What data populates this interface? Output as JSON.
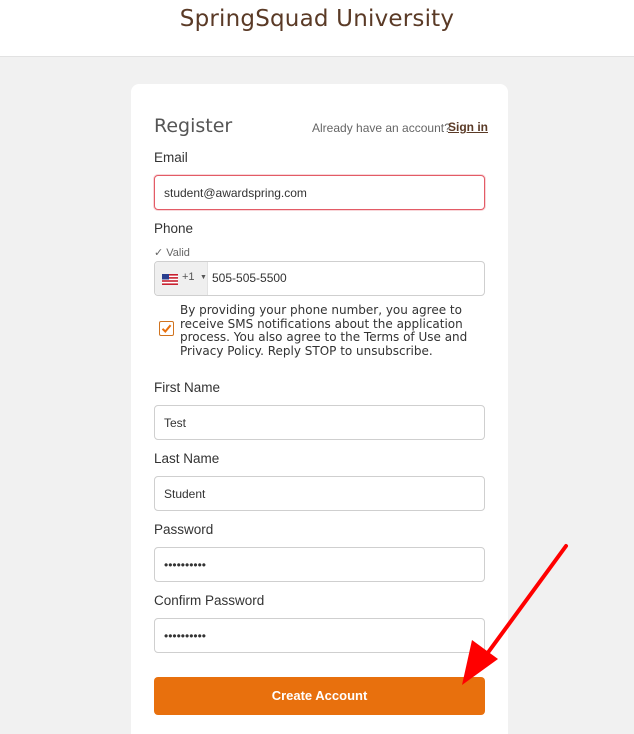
{
  "header": {
    "title": "SpringSquad University"
  },
  "form": {
    "title": "Register",
    "already_text": "Already have an account?",
    "signin_label": "Sign in",
    "email": {
      "label": "Email",
      "value": "student@awardspring.com"
    },
    "phone": {
      "label": "Phone",
      "status": "✓ Valid",
      "dial_code": "+1",
      "value": "505-505-5500",
      "country_icon": "us-flag-icon"
    },
    "sms_consent": {
      "checked": true,
      "text": "By providing your phone number, you agree to receive SMS notifications about the application process. You also agree to the Terms of Use and Privacy Policy. Reply STOP to unsubscribe."
    },
    "first_name": {
      "label": "First Name",
      "value": "Test"
    },
    "last_name": {
      "label": "Last Name",
      "value": "Student"
    },
    "password": {
      "label": "Password",
      "value": "••••••••••"
    },
    "confirm_password": {
      "label": "Confirm Password",
      "value": "••••••••••"
    },
    "submit_label": "Create Account"
  },
  "colors": {
    "brand": "#5a3a26",
    "accent": "#e8700d",
    "error": "#e35b66",
    "annotation_arrow": "#ff0000"
  }
}
